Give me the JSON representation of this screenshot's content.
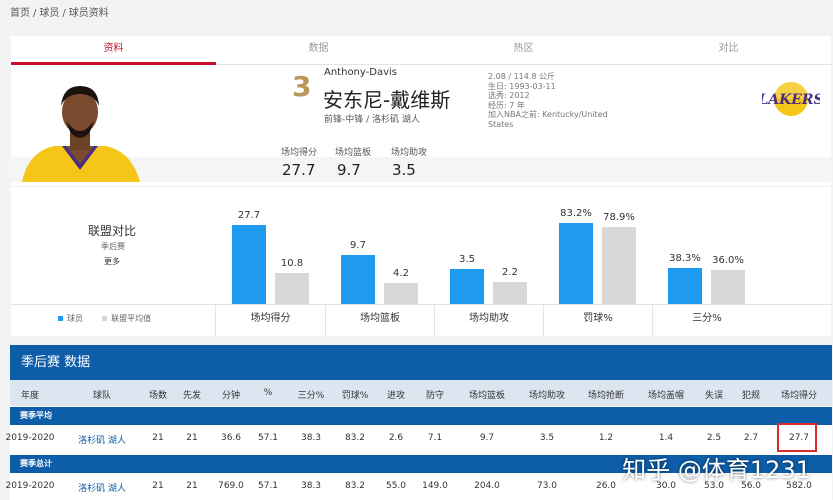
{
  "breadcrumb": [
    "首页",
    "/",
    "球员",
    "/",
    "球员资料"
  ],
  "tabs": [
    "资料",
    "数据",
    "热区",
    "对比"
  ],
  "player": {
    "number": "3",
    "english_name": "Anthony-Davis",
    "chinese_name": "安东尼-戴维斯",
    "position_team": "前锋-中锋 / 洛杉矶 湖人",
    "info": [
      "2.08 / 114.8 公斤",
      "生日: 1993-03-11",
      "选秀: 2012",
      "经历: 7 年",
      "加入NBA之前: Kentucky/United States"
    ],
    "logo_text": "LAKERS"
  },
  "header_stats": [
    {
      "label": "场均得分",
      "value": "27.7"
    },
    {
      "label": "场均篮板",
      "value": "9.7"
    },
    {
      "label": "场均助攻",
      "value": "3.5"
    }
  ],
  "league": {
    "title": "联盟对比",
    "subtitle": "季后赛",
    "more": "更多"
  },
  "legend": {
    "player": "球员",
    "avg": "联盟平均值",
    "player_color": "#1e9af0",
    "avg_color": "#d8d8d8"
  },
  "chart_data": {
    "type": "bar",
    "categories": [
      "场均得分",
      "场均篮板",
      "场均助攻",
      "罚球%",
      "三分%"
    ],
    "series": [
      {
        "name": "球员",
        "values": [
          27.7,
          9.7,
          3.5,
          83.2,
          38.3
        ],
        "labels": [
          "27.7",
          "9.7",
          "3.5",
          "83.2%",
          "38.3%"
        ]
      },
      {
        "name": "联盟平均值",
        "values": [
          10.8,
          4.2,
          2.2,
          78.9,
          36.0
        ],
        "labels": [
          "10.8",
          "4.2",
          "2.2",
          "78.9%",
          "36.0%"
        ]
      }
    ]
  },
  "table": {
    "title": "季后赛  数据",
    "headers": [
      "年度",
      "球队",
      "场数",
      "先发",
      "分钟",
      "%",
      "三分%",
      "罚球%",
      "进攻",
      "防守",
      "场均篮板",
      "场均助攻",
      "场均抢断",
      "场均盖帽",
      "失误",
      "犯规",
      "场均得分"
    ],
    "groups": [
      {
        "label": "赛季平均",
        "rows": [
          [
            "2019-2020",
            "洛杉矶 湖人",
            "21",
            "21",
            "36.6",
            "57.1",
            "38.3",
            "83.2",
            "2.6",
            "7.1",
            "9.7",
            "3.5",
            "1.2",
            "1.4",
            "2.5",
            "2.7",
            "27.7"
          ]
        ]
      },
      {
        "label": "赛季总计",
        "rows": [
          [
            "2019-2020",
            "洛杉矶 湖人",
            "21",
            "21",
            "769.0",
            "57.1",
            "38.3",
            "83.2",
            "55.0",
            "149.0",
            "204.0",
            "73.0",
            "26.0",
            "30.0",
            "53.0",
            "56.0",
            "582.0"
          ]
        ]
      }
    ]
  },
  "watermark": "知乎 @体育1231"
}
